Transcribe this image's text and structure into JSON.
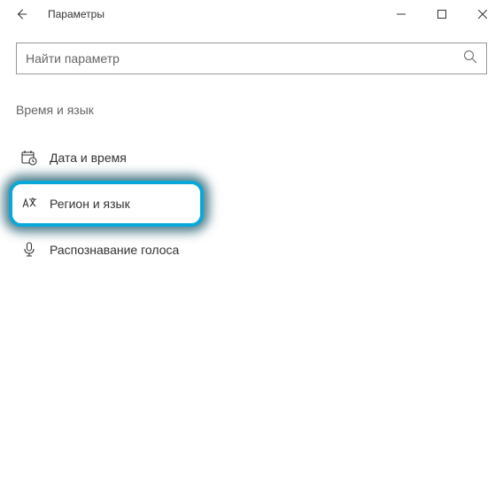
{
  "window": {
    "title": "Параметры"
  },
  "search": {
    "placeholder": "Найти параметр"
  },
  "section": {
    "title": "Время и язык"
  },
  "nav": {
    "items": [
      {
        "label": "Дата и время"
      },
      {
        "label": "Регион и язык"
      },
      {
        "label": "Распознавание голоса"
      }
    ]
  }
}
